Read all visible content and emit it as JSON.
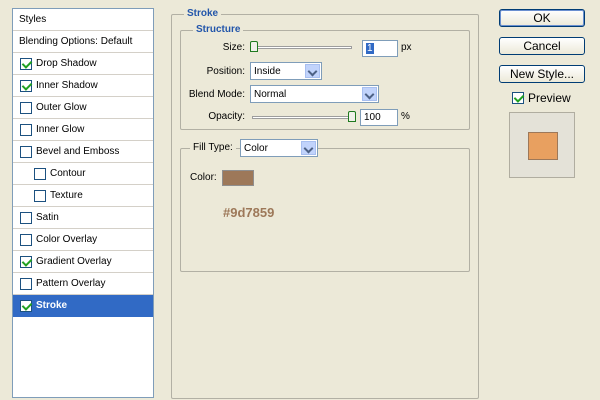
{
  "styles_list": {
    "header": "Styles",
    "blending": "Blending Options: Default",
    "items": [
      {
        "label": "Drop Shadow",
        "checked": true,
        "indent": false
      },
      {
        "label": "Inner Shadow",
        "checked": true,
        "indent": false
      },
      {
        "label": "Outer Glow",
        "checked": false,
        "indent": false
      },
      {
        "label": "Inner Glow",
        "checked": false,
        "indent": false
      },
      {
        "label": "Bevel and Emboss",
        "checked": false,
        "indent": false
      },
      {
        "label": "Contour",
        "checked": false,
        "indent": true
      },
      {
        "label": "Texture",
        "checked": false,
        "indent": true
      },
      {
        "label": "Satin",
        "checked": false,
        "indent": false
      },
      {
        "label": "Color Overlay",
        "checked": false,
        "indent": false
      },
      {
        "label": "Gradient Overlay",
        "checked": true,
        "indent": false
      },
      {
        "label": "Pattern Overlay",
        "checked": false,
        "indent": false
      },
      {
        "label": "Stroke",
        "checked": true,
        "indent": false,
        "selected": true
      }
    ]
  },
  "stroke": {
    "title": "Stroke",
    "structure_title": "Structure",
    "size_label": "Size:",
    "size_value": "1",
    "size_unit": "px",
    "position_label": "Position:",
    "position_value": "Inside",
    "blend_label": "Blend Mode:",
    "blend_value": "Normal",
    "opacity_label": "Opacity:",
    "opacity_value": "100",
    "opacity_unit": "%",
    "fill_type_label": "Fill Type:",
    "fill_type_value": "Color",
    "color_label": "Color:",
    "color_hex": "#9d7859",
    "color_text": "#9d7859"
  },
  "buttons": {
    "ok": "OK",
    "cancel": "Cancel",
    "new_style": "New Style...",
    "preview": "Preview"
  },
  "preview": {
    "checked": true,
    "swatch_color": "#e8a060"
  },
  "colors": {
    "selection": "#316ac5",
    "heading": "#2255aa"
  }
}
